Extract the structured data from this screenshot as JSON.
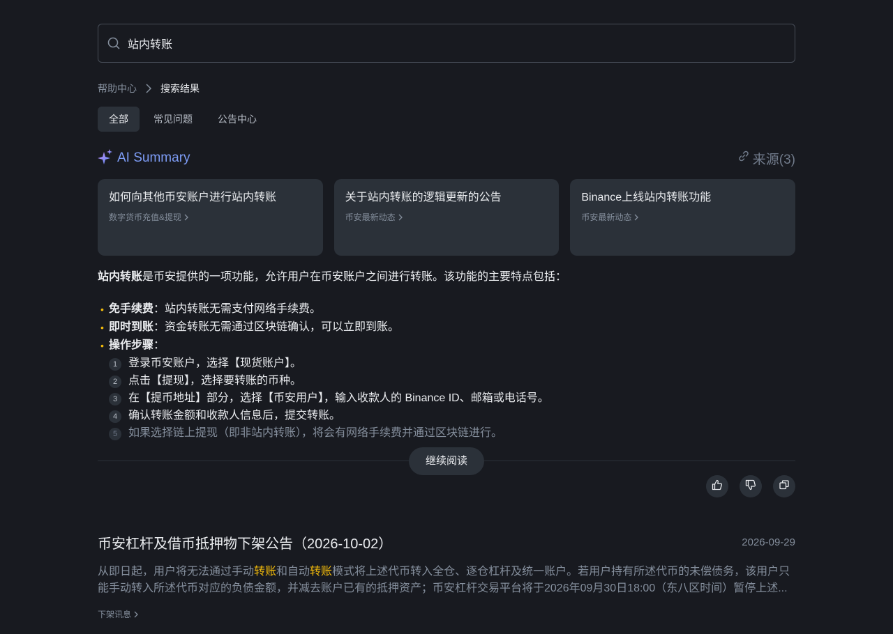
{
  "search": {
    "value": "站内转账",
    "placeholder": ""
  },
  "breadcrumb": {
    "home": "帮助中心",
    "current": "搜索结果"
  },
  "tabs": [
    {
      "label": "全部",
      "active": true
    },
    {
      "label": "常见问题",
      "active": false
    },
    {
      "label": "公告中心",
      "active": false
    }
  ],
  "ai": {
    "title": "AI Summary",
    "sources_label": "来源(3)",
    "cards": [
      {
        "title": "如何向其他币安账户进行站内转账",
        "category": "数字货币充值&提现"
      },
      {
        "title": "关于站内转账的逻辑更新的公告",
        "category": "币安最新动态"
      },
      {
        "title": "Binance上线站内转账功能",
        "category": "币安最新动态"
      }
    ],
    "intro_bold": "站内转账",
    "intro_rest": "是币安提供的一项功能，允许用户在币安账户之间进行转账。该功能的主要特点包括：",
    "bullets": [
      {
        "dot": "•",
        "bold": "免手续费",
        "text": "：站内转账无需支付网络手续费。"
      },
      {
        "dot": "•",
        "bold": "即时到账",
        "text": "：资金转账无需通过区块链确认，可以立即到账。"
      },
      {
        "dot": "•",
        "bold": "操作步骤",
        "text": "："
      }
    ],
    "steps": [
      {
        "num": "1",
        "text": "登录币安账户，选择【现货账户】。"
      },
      {
        "num": "2",
        "text": "点击【提现】，选择要转账的币种。"
      },
      {
        "num": "3",
        "text": "在【提币地址】部分，选择【币安用户】，输入收款人的 Binance ID、邮箱或电话号。"
      },
      {
        "num": "4",
        "text": "确认转账金额和收款人信息后，提交转账。"
      },
      {
        "num": "5",
        "text": "如果选择链上提现（即非站内转账），将会有网络手续费并通过区块链进行。"
      }
    ],
    "continue_label": "继续阅读"
  },
  "result": {
    "title": "币安杠杆及借币抵押物下架公告（2026-10-02）",
    "date": "2026-09-29",
    "body_1": "从即日起，用户将无法通过手动",
    "hl_1": "转账",
    "body_2": "和自动",
    "hl_2": "转账",
    "body_3": "模式将上述代币转入全仓、逐仓杠杆及统一账户。若用户持有所述代币的未偿债务，该用户只能手动转入所述代币对应的负债金额，并减去账户已有的抵押资产；币安杠杆交易平台将于2026年09月30日18:00（东八区时间）暂停上述...",
    "tag": "下架讯息"
  },
  "colors": {
    "background": "#181a20",
    "card": "#2b3139",
    "highlight": "#f0b90b",
    "ai_accent": "#7d9cf5"
  }
}
